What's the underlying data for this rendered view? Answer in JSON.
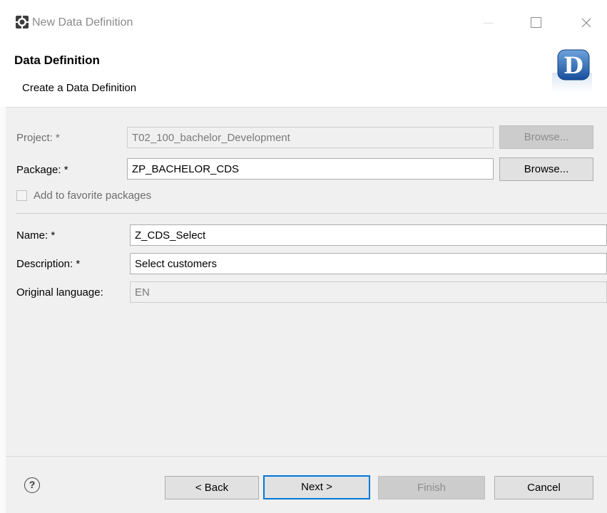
{
  "window": {
    "title": "New Data Definition",
    "icon": "eclipse-app-icon"
  },
  "header": {
    "title": "Data Definition",
    "description": "Create a Data Definition",
    "logo_letter": "D"
  },
  "form": {
    "project": {
      "label": "Project: *",
      "value": "T02_100_bachelor_Development",
      "browse": "Browse...",
      "enabled": false
    },
    "package": {
      "label": "Package: *",
      "value": "ZP_BACHELOR_CDS",
      "browse": "Browse..."
    },
    "favorite": {
      "label": "Add to favorite packages",
      "checked": false,
      "enabled": false
    },
    "name": {
      "label": "Name: *",
      "value": "Z_CDS_Select"
    },
    "description": {
      "label": "Description: *",
      "value": "Select customers"
    },
    "original_language": {
      "label": "Original language:",
      "value": "EN",
      "enabled": false
    }
  },
  "footer": {
    "help_icon": "?",
    "back": "< Back",
    "next": "Next >",
    "finish": "Finish",
    "cancel": "Cancel"
  },
  "colors": {
    "accent": "#0078d7",
    "logo_blue": "#1e5aa8"
  }
}
